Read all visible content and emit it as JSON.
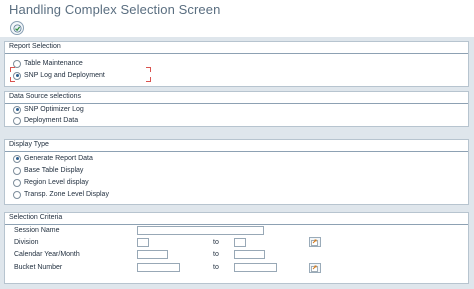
{
  "window": {
    "title": "Handling Complex Selection Screen"
  },
  "toolbar": {
    "execute_icon": "execute-icon"
  },
  "report_selection": {
    "title": "Report Selection",
    "options": [
      {
        "label": "Table Maintenance",
        "checked": false
      },
      {
        "label": "SNP Log and Deployment",
        "checked": true
      }
    ]
  },
  "data_source": {
    "title": "Data Source selections",
    "options": [
      {
        "label": "SNP Optimizer Log",
        "checked": true
      },
      {
        "label": "Deployment Data",
        "checked": false
      }
    ]
  },
  "display_type": {
    "title": "Display Type",
    "options": [
      {
        "label": "Generate Report Data",
        "checked": true
      },
      {
        "label": "Base Table Display",
        "checked": false
      },
      {
        "label": "Region Level display",
        "checked": false
      },
      {
        "label": "Transp. Zone Level Display",
        "checked": false
      }
    ]
  },
  "selection_criteria": {
    "title": "Selection Criteria",
    "to_label": "to",
    "fields": [
      {
        "label": "Session Name",
        "value": "",
        "has_range": false
      },
      {
        "label": "Division",
        "value": "",
        "to_value": "",
        "has_range": true,
        "multi_icon": "multiple-selection-icon"
      },
      {
        "label": "Calendar Year/Month",
        "value": "",
        "to_value": "",
        "has_range": true
      },
      {
        "label": "Bucket Number",
        "value": "",
        "to_value": "",
        "has_range": true,
        "multi_icon": "multiple-selection-icon"
      }
    ]
  },
  "colors": {
    "background": "#dfe6ec",
    "group_border": "#b7c4cf",
    "accent": "#2f5f8f",
    "focus": "#d9534f"
  }
}
